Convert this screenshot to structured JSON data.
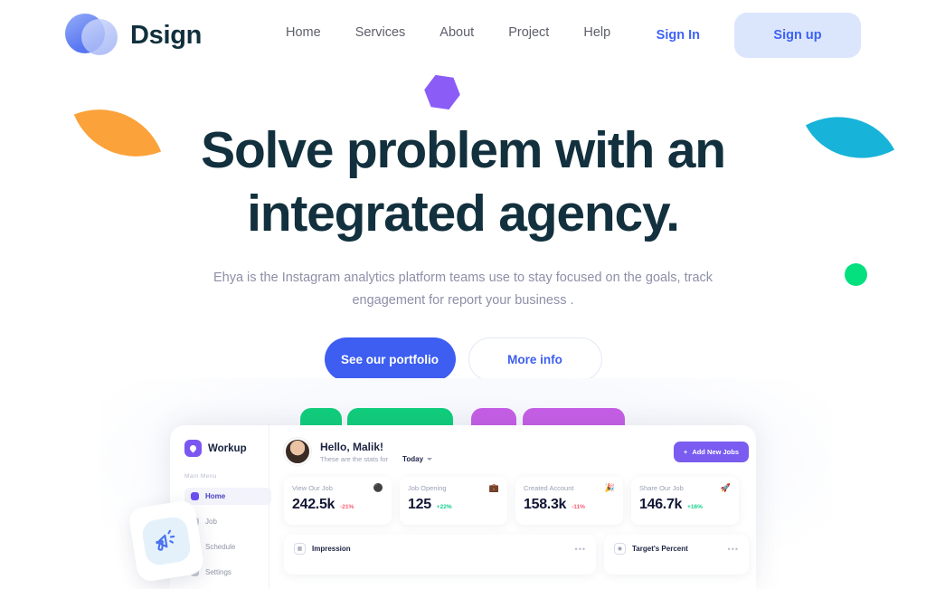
{
  "brand": {
    "name": "Dsign",
    "logo_icon": "overlapping-circles-logo"
  },
  "nav": {
    "items": [
      {
        "label": "Home"
      },
      {
        "label": "Services"
      },
      {
        "label": "About"
      },
      {
        "label": "Project"
      },
      {
        "label": "Help"
      }
    ],
    "sign_in": "Sign In",
    "sign_up": "Sign up"
  },
  "hero": {
    "title_line1": "Solve problem with an",
    "title_line2": "integrated agency.",
    "subtitle": "Ehya is the Instagram analytics platform teams use to stay focused on the goals, track engagement for report your business .",
    "cta_primary": "See our portfolio",
    "cta_secondary": "More info"
  },
  "decor": {
    "hexagon_color": "#8b5cf6",
    "leaf_orange_color": "#fba23a",
    "leaf_cyan_color": "#18b3d9",
    "dot_green_color": "#03e07d",
    "tab_green_color": "#10cf7c",
    "tab_purple_color": "#c65fe6",
    "megaphone_icon": "megaphone-icon"
  },
  "colors": {
    "primary_blue": "#3d5ef0",
    "signup_bg": "#dbe6fd",
    "heading_navy": "#12303d",
    "body_gray": "#8e8fa8",
    "dashboard_purple": "#7a5cf0"
  },
  "dashboard": {
    "brand": "Workup",
    "menu_label": "Main Menu",
    "menu_items": [
      {
        "label": "Home",
        "active": true
      },
      {
        "label": "Job",
        "active": false
      },
      {
        "label": "Schedule",
        "active": false
      },
      {
        "label": "Settings",
        "active": false
      }
    ],
    "greeting": "Hello, Malik!",
    "greeting_sub": "These are the stats for",
    "range_selected": "Today",
    "add_button": "Add New Jobs",
    "stats": [
      {
        "title": "View Our Job",
        "value": "242.5k",
        "delta": "-21%",
        "direction": "down",
        "emoji": "⚫"
      },
      {
        "title": "Job Opening",
        "value": "125",
        "delta": "+22%",
        "direction": "up",
        "emoji": "💼"
      },
      {
        "title": "Created Account",
        "value": "158.3k",
        "delta": "-11%",
        "direction": "down",
        "emoji": "🎉"
      },
      {
        "title": "Share Our Job",
        "value": "146.7k",
        "delta": "+16%",
        "direction": "up",
        "emoji": "🚀"
      }
    ],
    "panels": [
      {
        "title": "Impression",
        "icon": "bar-chart-icon",
        "menu": "•••"
      },
      {
        "title": "Target's Percent",
        "icon": "target-icon",
        "menu": "•••"
      }
    ]
  }
}
